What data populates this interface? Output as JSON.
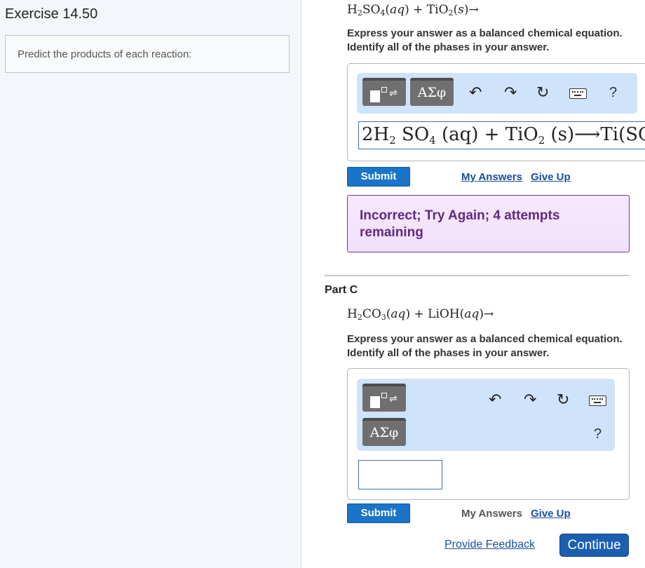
{
  "left_panel": {
    "exercise_title": "Exercise 14.50",
    "prompt": "Predict the products of each reaction:"
  },
  "part_b": {
    "reaction": {
      "r1": "H",
      "r1_sub": "2",
      "r1b": "SO",
      "r1b_sub": "4",
      "r1_phase": "aq",
      "plus": "+",
      "r2": "TiO",
      "r2_sub": "2",
      "r2_phase": "s",
      "arrow": "→"
    },
    "instructions": "Express your answer as a balanced chemical equation. Identify all of the phases in your answer.",
    "toolbar": {
      "greek_label": "ΑΣφ",
      "undo_glyph": "↶",
      "redo_glyph": "↷",
      "reset_glyph": "↻",
      "help_glyph": "?"
    },
    "answer": {
      "p1": "2H",
      "p1_sub": "2",
      "p2": " SO",
      "p2_sub": "4",
      "p3": " (aq) + TiO",
      "p3_sub": "2",
      "p4": " (s)⟶Ti(SO"
    },
    "submit_label": "Submit",
    "my_answers_label": "My Answers",
    "give_up_label": "Give Up",
    "feedback": "Incorrect; Try Again; 4 attempts remaining"
  },
  "part_c": {
    "label": "Part C",
    "reaction": {
      "r1": "H",
      "r1_sub": "2",
      "r1b": "CO",
      "r1b_sub": "3",
      "r1_phase": "aq",
      "plus": "+",
      "r2": "LiOH",
      "r2_phase": "aq",
      "arrow": "→"
    },
    "instructions": "Express your answer as a balanced chemical equation. Identify all of the phases in your answer.",
    "toolbar": {
      "greek_label": "ΑΣφ",
      "undo_glyph": "↶",
      "redo_glyph": "↷",
      "reset_glyph": "↻",
      "help_glyph": "?"
    },
    "answer_value": "",
    "submit_label": "Submit",
    "my_answers_label": "My Answers",
    "give_up_label": "Give Up"
  },
  "footer": {
    "feedback_link": "Provide Feedback",
    "continue_label": "Continue"
  },
  "colors": {
    "submit_blue": "#1a74c8",
    "continue_blue": "#1c5fb1",
    "toolbar_bg": "#cfe3fb",
    "feedback_text": "#5e2a82",
    "feedback_bg": "#f6e8fc"
  }
}
